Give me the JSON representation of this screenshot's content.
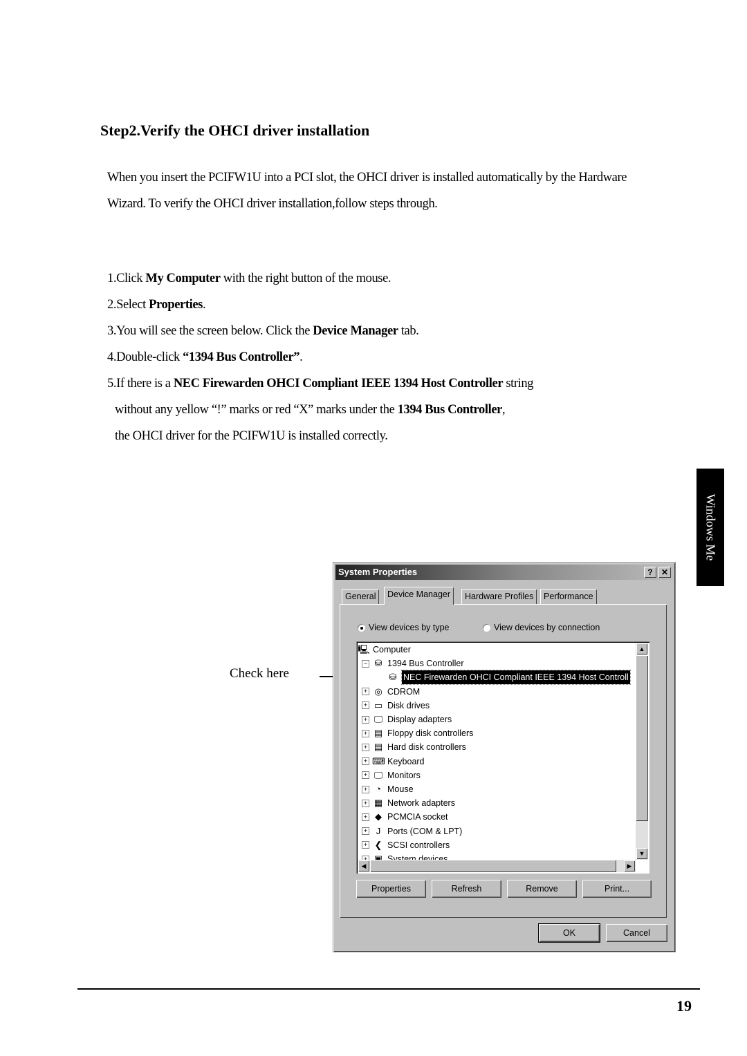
{
  "heading": "Step2.Verify the OHCI driver installation",
  "intro": "When you insert the PCIFW1U into a PCI slot, the OHCI driver is installed automatically by the Hardware Wizard. To verify the OHCI driver installation,follow steps through.",
  "steps": {
    "s1": {
      "a": "1.Click ",
      "b": "My Computer",
      "c": " with the right button of the mouse."
    },
    "s2": {
      "a": "2.Select ",
      "b": "Properties",
      "c": "."
    },
    "s3": {
      "a": "3.You will see the screen below. Click the ",
      "b": "Device Manager",
      "c": " tab."
    },
    "s4": {
      "a": "4.Double-click ",
      "b": "“1394 Bus Controller”",
      "c": "."
    },
    "s5": {
      "a": "5.If there is a ",
      "b": "NEC Firewarden OHCI Compliant IEEE 1394 Host Controller",
      "c": " string"
    },
    "s6": {
      "a": "without any yellow “!” marks or red “X” marks under the ",
      "b": "1394 Bus Controller",
      "c": ","
    },
    "s7": "the OHCI driver for the PCIFW1U is installed correctly."
  },
  "side_tab": "Windows Me",
  "callout": "Check here",
  "page_number": "19",
  "dialog": {
    "title": "System Properties",
    "help": "?",
    "close": "✕",
    "tabs": [
      "General",
      "Device Manager",
      "Hardware Profiles",
      "Performance"
    ],
    "radio_type": "View devices by type",
    "radio_conn": "View devices by connection",
    "tree": [
      {
        "label": "Computer",
        "icon": "🖳"
      },
      {
        "label": "1394 Bus Controller",
        "icon": "⛁",
        "exp": "−"
      },
      {
        "label": "NEC Firewarden OHCI Compliant IEEE 1394 Host Controll",
        "icon": "⛁",
        "selected": true
      },
      {
        "label": "CDROM",
        "icon": "◎",
        "exp": "+"
      },
      {
        "label": "Disk drives",
        "icon": "▭",
        "exp": "+"
      },
      {
        "label": "Display adapters",
        "icon": "🖵",
        "exp": "+"
      },
      {
        "label": "Floppy disk controllers",
        "icon": "▤",
        "exp": "+"
      },
      {
        "label": "Hard disk controllers",
        "icon": "▤",
        "exp": "+"
      },
      {
        "label": "Keyboard",
        "icon": "⌨",
        "exp": "+"
      },
      {
        "label": "Monitors",
        "icon": "🖵",
        "exp": "+"
      },
      {
        "label": "Mouse",
        "icon": "◔",
        "exp": "+"
      },
      {
        "label": "Network adapters",
        "icon": "▦",
        "exp": "+"
      },
      {
        "label": "PCMCIA socket",
        "icon": "◆",
        "exp": "+"
      },
      {
        "label": "Ports (COM & LPT)",
        "icon": "Ј",
        "exp": "+"
      },
      {
        "label": "SCSI controllers",
        "icon": "❮",
        "exp": "+"
      },
      {
        "label": "System devices",
        "icon": "▣",
        "exp": "+"
      }
    ],
    "buttons": {
      "properties": "Properties",
      "refresh": "Refresh",
      "remove": "Remove",
      "print": "Print...",
      "ok": "OK",
      "cancel": "Cancel"
    }
  }
}
